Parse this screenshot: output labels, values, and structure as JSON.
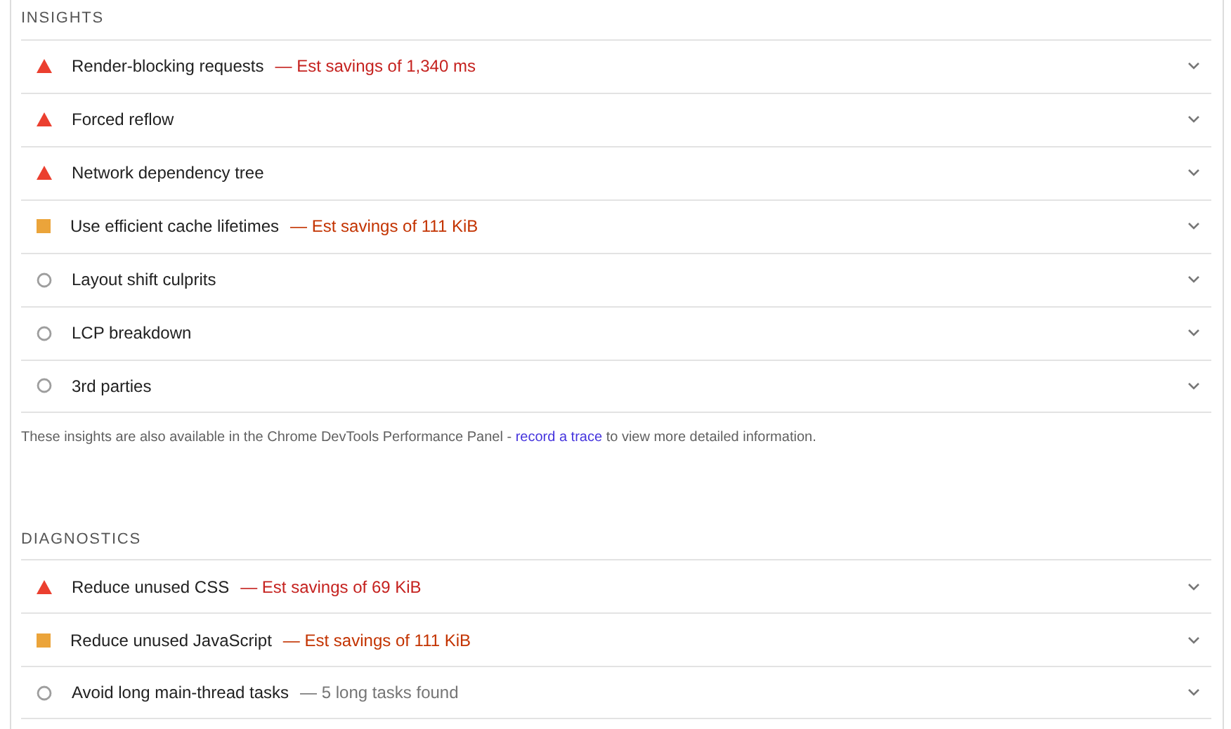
{
  "sections": [
    {
      "heading": "INSIGHTS",
      "audits": [
        {
          "kind": "fail",
          "title": "Render-blocking requests",
          "detail": "— Est savings of 1,340 ms"
        },
        {
          "kind": "fail",
          "title": "Forced reflow"
        },
        {
          "kind": "fail",
          "title": "Network dependency tree"
        },
        {
          "kind": "average",
          "title": "Use efficient cache lifetimes",
          "detail": "— Est savings of 111 KiB"
        },
        {
          "kind": "info",
          "title": "Layout shift culprits"
        },
        {
          "kind": "info",
          "title": "LCP breakdown"
        },
        {
          "kind": "info",
          "title": "3rd parties"
        }
      ],
      "note": {
        "before": "These insights are also available in the Chrome DevTools Performance Panel - ",
        "link": "record a trace",
        "after": " to view more detailed information."
      }
    },
    {
      "heading": "DIAGNOSTICS",
      "audits": [
        {
          "kind": "fail",
          "title": "Reduce unused CSS",
          "detail": "— Est savings of 69 KiB"
        },
        {
          "kind": "average",
          "title": "Reduce unused JavaScript",
          "detail": "— Est savings of 111 KiB"
        },
        {
          "kind": "info",
          "title": "Avoid long main-thread tasks",
          "detail": "— 5 long tasks found"
        }
      ]
    }
  ]
}
